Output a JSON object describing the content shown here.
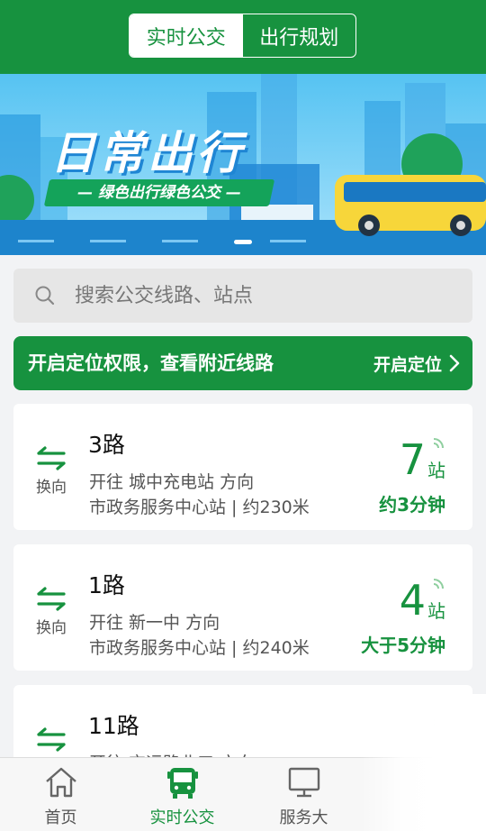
{
  "header": {
    "tabs": [
      {
        "label": "实时公交",
        "active": true
      },
      {
        "label": "出行规划",
        "active": false
      }
    ]
  },
  "banner": {
    "title": "日常出行",
    "subtitle": "— 绿色出行绿色公交 —"
  },
  "search": {
    "placeholder": "搜索公交线路、站点",
    "icon": "search-icon"
  },
  "location_prompt": {
    "message": "开启定位权限，查看附近线路",
    "button_label": "开启定位"
  },
  "routes": [
    {
      "name": "3路",
      "swap_label": "换向",
      "direction": "开往 城中充电站 方向",
      "nearby": "市政务服务中心站 | 约230米",
      "stops": "7",
      "stops_unit": "站",
      "eta": "约3分钟"
    },
    {
      "name": "1路",
      "swap_label": "换向",
      "direction": "开往 新一中 方向",
      "nearby": "市政务服务中心站 | 约240米",
      "stops": "4",
      "stops_unit": "站",
      "eta": "大于5分钟"
    },
    {
      "name": "11路",
      "swap_label": "换向",
      "direction": "开往 交运路北口 方向",
      "nearby": "",
      "stops": "",
      "stops_unit": "",
      "eta": ""
    }
  ],
  "tabbar": {
    "items": [
      {
        "label": "首页",
        "icon": "home-icon"
      },
      {
        "label": "实时公交",
        "icon": "bus-icon",
        "active": true
      },
      {
        "label": "服务大",
        "icon": "monitor-icon"
      }
    ]
  },
  "colors": {
    "primary": "#17923f",
    "background": "#f2f3f5"
  }
}
